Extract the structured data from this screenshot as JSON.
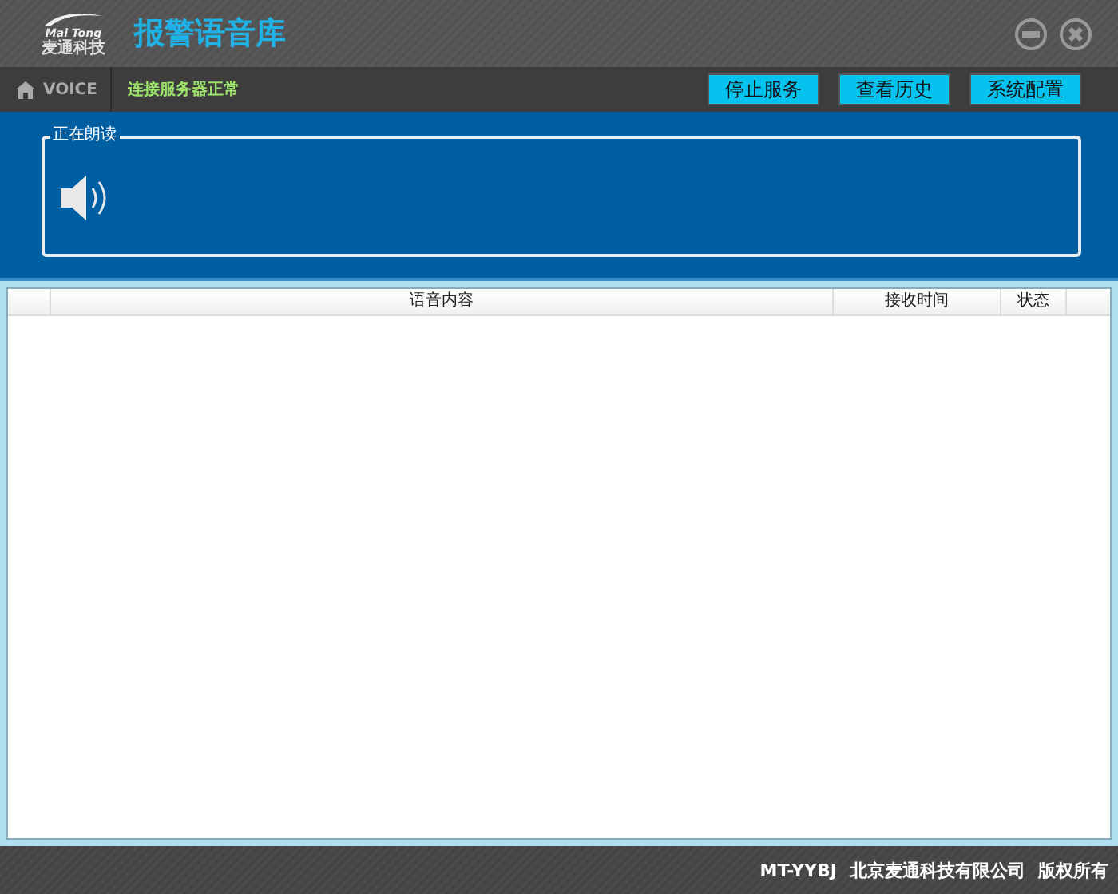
{
  "logo": {
    "latin": "Mai Tong",
    "chinese": "麦通科技"
  },
  "window": {
    "title": "报警语音库"
  },
  "toolbar": {
    "section": "VOICE",
    "status": "连接服务器正常",
    "buttons": [
      "停止服务",
      "查看历史",
      "系统配置"
    ]
  },
  "now_reading": {
    "legend": "正在朗读"
  },
  "table": {
    "columns": [
      "语音内容",
      "接收时间",
      "状态"
    ]
  },
  "status_bar": {
    "product": "MT-YYBJ",
    "company": "北京麦通科技有限公司",
    "rights": "版权所有"
  }
}
